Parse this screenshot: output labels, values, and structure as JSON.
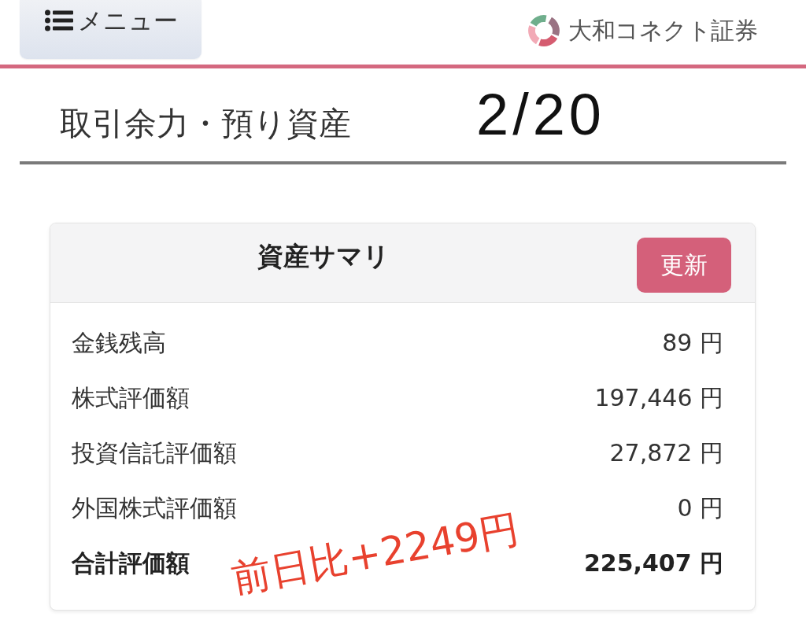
{
  "header": {
    "menu_button": {
      "label": "メニュー"
    },
    "brand": {
      "name": "大和コネクト証券"
    }
  },
  "page_title": "取引余力・預り資産",
  "annotations": [
    {
      "kind": "date",
      "text": "2/20",
      "color": "#111111"
    },
    {
      "kind": "note",
      "text": "前日比+2249円",
      "color": "#e8412e"
    }
  ],
  "asset_summary": {
    "title": "資産サマリ",
    "refresh_button": {
      "label": "更新"
    },
    "rows": [
      {
        "kind": "item",
        "label": "金銭残高",
        "value": "89 円"
      },
      {
        "kind": "item",
        "label": "株式評価額",
        "value": "197,446 円"
      },
      {
        "kind": "item",
        "label": "投資信託評価額",
        "value": "27,872 円"
      },
      {
        "kind": "item",
        "label": "外国株式評価額",
        "value": "0 円"
      },
      {
        "kind": "total",
        "label": "合計評価額",
        "value": "225,407 円"
      }
    ]
  }
}
